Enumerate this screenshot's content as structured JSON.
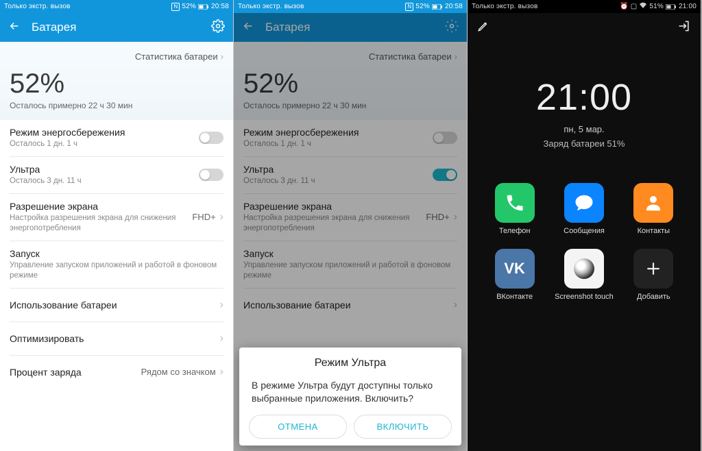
{
  "phone1": {
    "status": {
      "carrier": "Только экстр. вызов",
      "nfc": "N",
      "batt": "52%",
      "time": "20:58"
    },
    "header": {
      "title": "Батарея"
    },
    "hero": {
      "stats_link": "Статистика батареи",
      "pct": "52%",
      "remain": "Осталось примерно 22 ч 30 мин"
    },
    "rows": {
      "saver": {
        "title": "Режим энергосбережения",
        "sub": "Осталось 1 дн. 1 ч"
      },
      "ultra": {
        "title": "Ультра",
        "sub": "Осталось 3 дн. 11 ч"
      },
      "res": {
        "title": "Разрешение экрана",
        "sub": "Настройка разрешения экрана для снижения энергопотребления",
        "val": "FHD+"
      },
      "launch": {
        "title": "Запуск",
        "sub": "Управление запуском приложений и работой в фоновом режиме"
      },
      "usage": {
        "title": "Использование батареи"
      },
      "opt": {
        "title": "Оптимизировать"
      },
      "pct": {
        "title": "Процент заряда",
        "val": "Рядом со значком"
      }
    }
  },
  "phone2": {
    "status": {
      "carrier": "Только экстр. вызов",
      "nfc": "N",
      "batt": "52%",
      "time": "20:58"
    },
    "header": {
      "title": "Батарея"
    },
    "hero": {
      "stats_link": "Статистика батареи",
      "pct": "52%",
      "remain": "Осталось примерно 22 ч 30 мин"
    },
    "rows": {
      "saver": {
        "title": "Режим энергосбережения",
        "sub": "Осталось 1 дн. 1 ч"
      },
      "ultra": {
        "title": "Ультра",
        "sub": "Осталось 3 дн. 11 ч"
      },
      "res": {
        "title": "Разрешение экрана",
        "sub": "Настройка разрешения экрана для снижения энергопотребления",
        "val": "FHD+"
      },
      "launch": {
        "title": "Запуск",
        "sub": "Управление запуском приложений и работой в фоновом режиме"
      },
      "usage": {
        "title": "Использование батареи"
      }
    },
    "dialog": {
      "title": "Режим Ультра",
      "body": "В режиме Ультра будут доступны только выбранные приложения. Включить?",
      "cancel": "ОТМЕНА",
      "ok": "ВКЛЮЧИТЬ"
    }
  },
  "phone3": {
    "status": {
      "carrier": "Только экстр. вызов",
      "batt": "51%",
      "time": "21:00"
    },
    "clock": "21:00",
    "date": "пн, 5 мар.",
    "charge": "Заряд батареи 51%",
    "apps": [
      {
        "label": "Телефон"
      },
      {
        "label": "Сообщения"
      },
      {
        "label": "Контакты"
      },
      {
        "label": "ВКонтакте"
      },
      {
        "label": "Screenshot touch"
      },
      {
        "label": "Добавить"
      }
    ]
  }
}
